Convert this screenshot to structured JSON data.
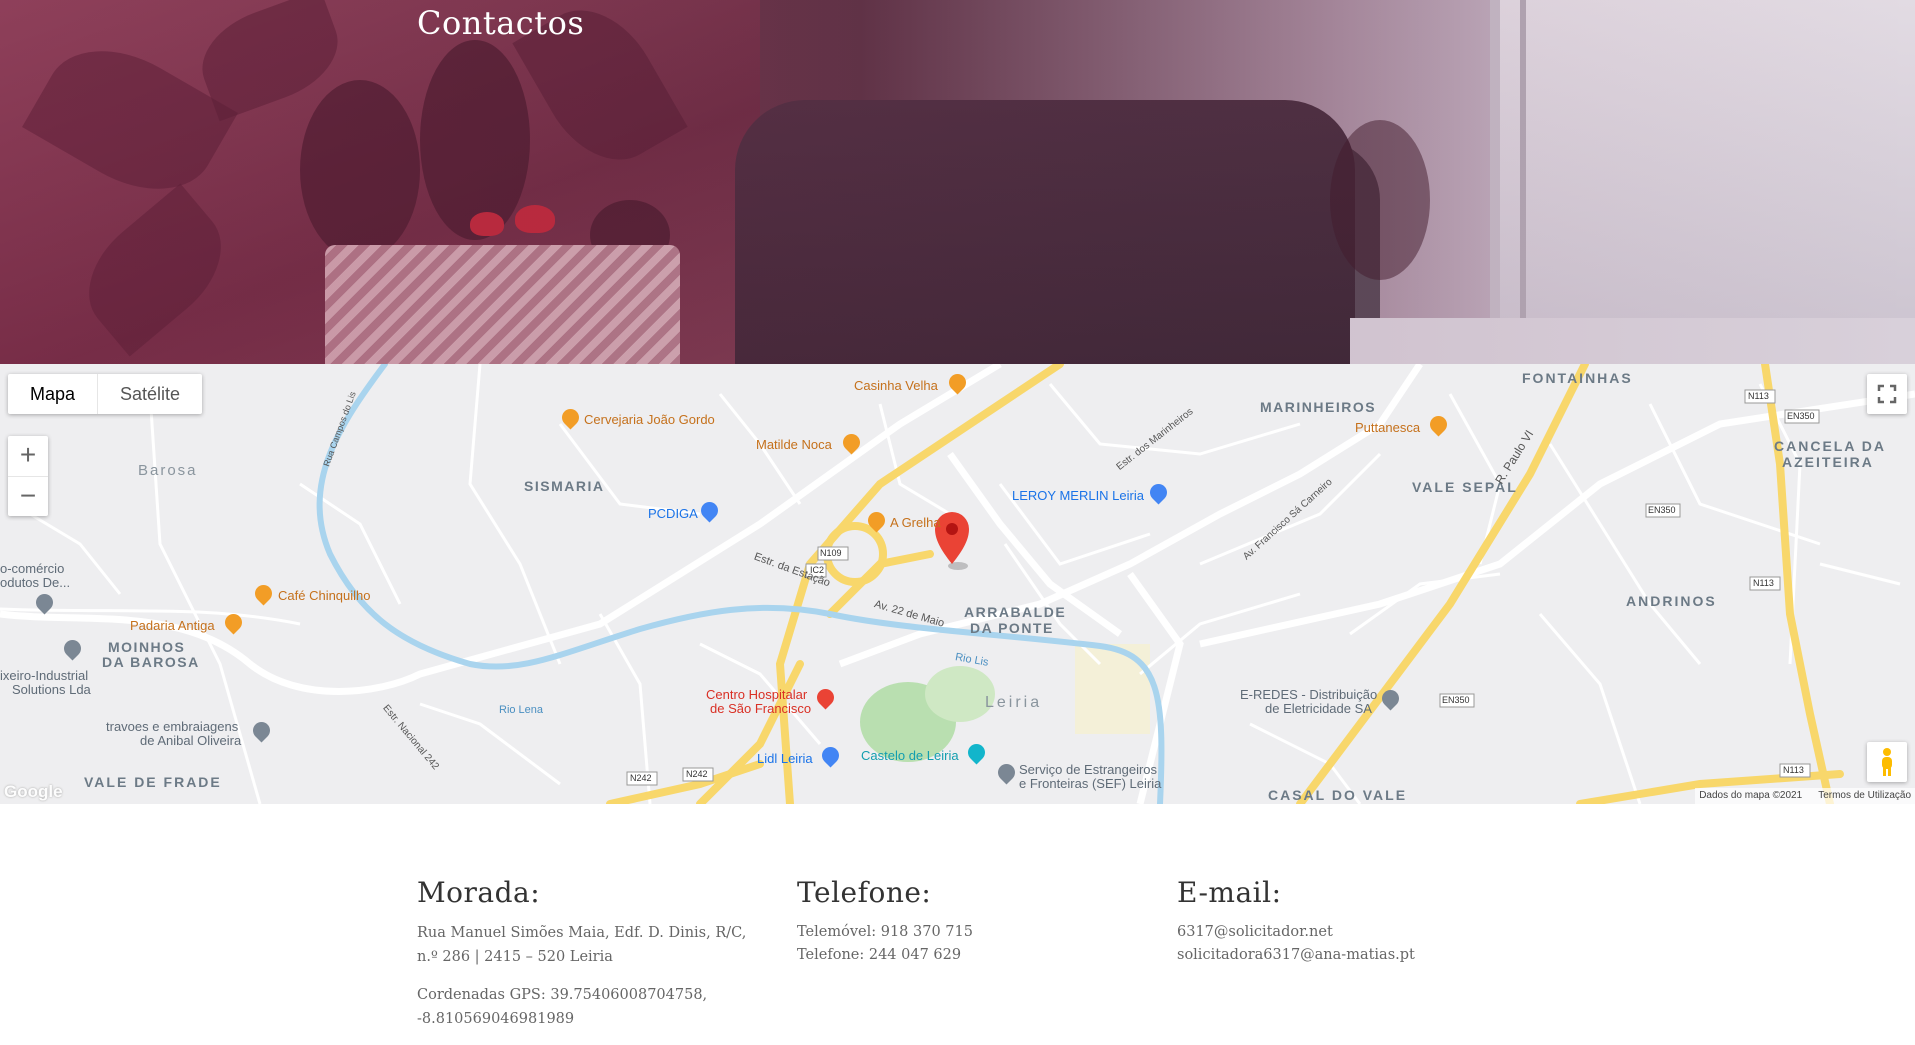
{
  "hero": {
    "title": "Contactos"
  },
  "map": {
    "type_control": {
      "map_label": "Mapa",
      "satellite_label": "Satélite"
    },
    "zoom_in_label": "+",
    "zoom_out_label": "−",
    "attribution": "Dados do mapa ©2021",
    "terms": "Termos de Utilização",
    "logo": "Google",
    "marker_color": "#ea4335",
    "place_labels": [
      {
        "text": "FONTAINHAS"
      },
      {
        "text": "MARINHEIROS"
      },
      {
        "text": "SISMARIA"
      },
      {
        "text": "VALE SEPAL"
      },
      {
        "text": "CANCELA DA"
      },
      {
        "text": "AZEITEIRA"
      },
      {
        "text": "ANDRINOS"
      },
      {
        "text": "ARRABALDE"
      },
      {
        "text": "DA PONTE"
      },
      {
        "text": "MOINHOS"
      },
      {
        "text": "DA BAROSA"
      },
      {
        "text": "Barosa"
      },
      {
        "text": "VALE DE FRADE"
      },
      {
        "text": "CASAL DO VALE"
      },
      {
        "text": "Leiria"
      }
    ],
    "pois": [
      {
        "text": "Casinha Velha",
        "icon": "restaurant-icon"
      },
      {
        "text": "Cervejaria João Gordo",
        "icon": "restaurant-icon"
      },
      {
        "text": "Matilde Noca",
        "icon": "restaurant-icon"
      },
      {
        "text": "Puttanesca",
        "icon": "restaurant-icon"
      },
      {
        "text": "PCDIGA",
        "icon": "shopping-icon"
      },
      {
        "text": "A Grelha",
        "icon": "restaurant-icon"
      },
      {
        "text": "LEROY MERLIN Leiria",
        "icon": "shopping-icon"
      },
      {
        "text": "Café Chinquilho",
        "icon": "cafe-icon"
      },
      {
        "text": "Padaria Antiga",
        "icon": "bakery-icon"
      },
      {
        "text": "Centro Hospitalar",
        "icon": "hospital-icon"
      },
      {
        "text": "de São Francisco",
        "icon": ""
      },
      {
        "text": "Lidl Leiria",
        "icon": "shopping-icon"
      },
      {
        "text": "Castelo de Leiria",
        "icon": "landmark-icon"
      },
      {
        "text": "Serviço de Estrangeiros",
        "icon": "government-icon"
      },
      {
        "text": "e Fronteiras (SEF) Leiria",
        "icon": ""
      },
      {
        "text": "E-REDES - Distribuição",
        "icon": "place-icon"
      },
      {
        "text": "de Eletricidade SA",
        "icon": ""
      },
      {
        "text": "travoes e embraiagens",
        "icon": "place-icon"
      },
      {
        "text": "de Anibal Oliveira",
        "icon": ""
      },
      {
        "text": "ixeiro-Industrial",
        "icon": "place-icon"
      },
      {
        "text": "Solutions Lda",
        "icon": ""
      },
      {
        "text": "o-comércio",
        "icon": ""
      },
      {
        "text": "odutos De...",
        "icon": ""
      }
    ],
    "street_labels": [
      {
        "text": "Estr. da Estação"
      },
      {
        "text": "Av. 22 de Maio"
      },
      {
        "text": "Rio Lis"
      },
      {
        "text": "Rio Lena"
      },
      {
        "text": "Estr. Nacional 242"
      },
      {
        "text": "R. Paulo VI"
      },
      {
        "text": "Av. Francisco Sá Carneiro"
      },
      {
        "text": "Estr. dos Marinheiros"
      },
      {
        "text": "Rua Campos do Lis"
      }
    ],
    "road_shields": [
      {
        "text": "N109"
      },
      {
        "text": "IC2"
      },
      {
        "text": "N242"
      },
      {
        "text": "N242"
      },
      {
        "text": "N113"
      },
      {
        "text": "N113"
      },
      {
        "text": "EN350"
      },
      {
        "text": "EN350"
      },
      {
        "text": "EN350"
      },
      {
        "text": "N113"
      }
    ]
  },
  "contact": {
    "address": {
      "heading": "Morada:",
      "line": "Rua Manuel Simões Maia, Edf. D. Dinis, R/C, n.º 286 | 2415 – 520 Leiria",
      "gps": "Cordenadas GPS: 39.75406008704758, -8.810569046981989"
    },
    "phone": {
      "heading": "Telefone:",
      "mobile": "Telemóvel: 918 370 715",
      "landline": "Telefone: 244 047 629"
    },
    "email": {
      "heading": "E-mail:",
      "primary": "6317@solicitador.net",
      "secondary": "solicitadora6317@ana-matias.pt"
    }
  }
}
